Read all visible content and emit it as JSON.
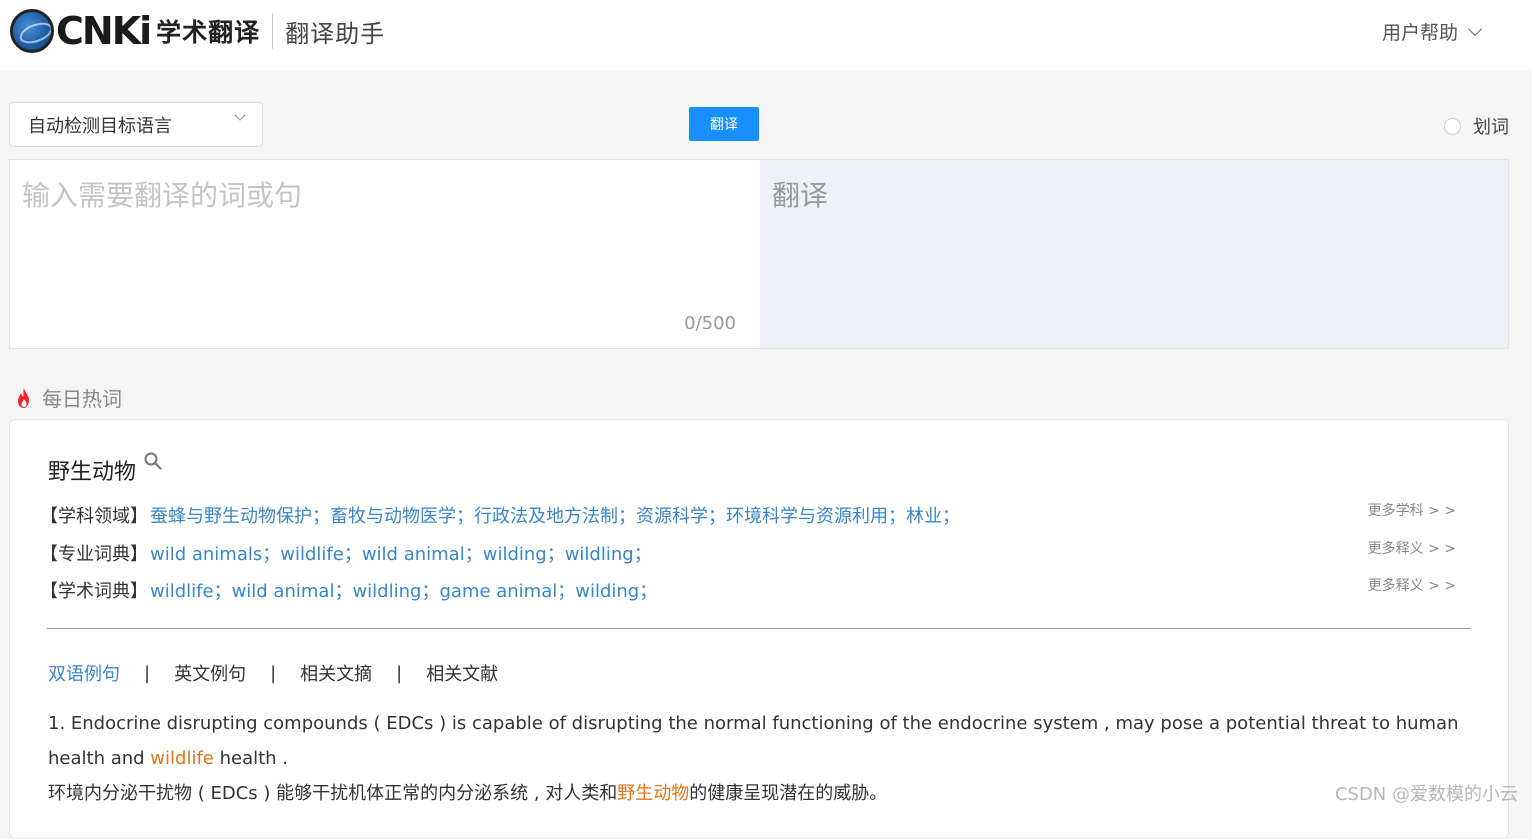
{
  "header": {
    "brand": "CNKi",
    "product": "学术翻译",
    "subtitle": "翻译助手",
    "help_label": "用户帮助"
  },
  "toolbar": {
    "lang_select_value": "自动检测目标语言",
    "translate_label": "翻译",
    "word_pick_label": "划词"
  },
  "input": {
    "placeholder": "输入需要翻译的词或句",
    "value": "",
    "counter": "0/500"
  },
  "output": {
    "placeholder": "翻译"
  },
  "hot_words": {
    "title": "每日热词",
    "word": "野生动物",
    "rows": [
      {
        "label": "【学科领域】",
        "items": [
          "蚕蜂与野生动物保护；",
          "畜牧与动物医学；",
          "行政法及地方法制；",
          "资源科学；",
          "环境科学与资源利用；",
          "林业；"
        ],
        "more": "更多学科 > >"
      },
      {
        "label": "【专业词典】",
        "items": [
          "wild animals；",
          "wildlife；",
          "wild animal；",
          "wilding；",
          "wildling；"
        ],
        "more": "更多释义 > >"
      },
      {
        "label": "【学术词典】",
        "items": [
          "wildlife；",
          "wild animal；",
          "wildling；",
          "game animal；",
          "wilding；"
        ],
        "more": "更多释义 > >"
      }
    ],
    "tabs": [
      "双语例句",
      "英文例句",
      "相关文摘",
      "相关文献"
    ],
    "tab_sep": "|",
    "example": {
      "en_before": "1. Endocrine disrupting compounds ( EDCs ) is capable of disrupting the normal functioning of the endocrine system , may pose a potential threat to human health and ",
      "en_highlight": "wildlife",
      "en_after": " health .",
      "zh_before": "环境内分泌干扰物 ( EDCs ) 能够干扰机体正常的内分泌系统 , 对人类和",
      "zh_highlight": "野生动物",
      "zh_after": "的健康呈现潜在的威胁。"
    }
  },
  "watermark": "CSDN @爱数模的小云",
  "colors": {
    "accent": "#1890ff",
    "link": "#3a86c8",
    "highlight": "#e3761f",
    "fire": "#f5222d"
  }
}
